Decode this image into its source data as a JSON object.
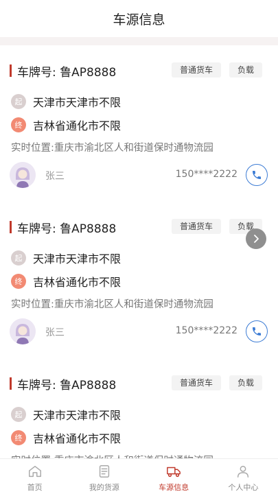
{
  "header": {
    "title": "车源信息"
  },
  "cards": [
    {
      "plate": "车牌号: 鲁AP8888",
      "tags": [
        "普通货车",
        "负载"
      ],
      "start_badge": "起",
      "start": "天津市天津市不限",
      "end_badge": "终",
      "end": "吉林省通化市不限",
      "location": "实时位置:重庆市渝北区人和街道保时通物流园",
      "name": "张三",
      "phone": "150****2222"
    },
    {
      "plate": "车牌号: 鲁AP8888",
      "tags": [
        "普通货车",
        "负载"
      ],
      "start_badge": "起",
      "start": "天津市天津市不限",
      "end_badge": "终",
      "end": "吉林省通化市不限",
      "location": "实时位置:重庆市渝北区人和街道保时通物流园",
      "name": "张三",
      "phone": "150****2222"
    },
    {
      "plate": "车牌号: 鲁AP8888",
      "tags": [
        "普通货车",
        "负载"
      ],
      "start_badge": "起",
      "start": "天津市天津市不限",
      "end_badge": "终",
      "end": "吉林省通化市不限",
      "location": "实时位置:重庆市渝北区人和街道保时通物流园",
      "name": "",
      "phone": ""
    }
  ],
  "tabbar": {
    "items": [
      {
        "label": "首页",
        "icon": "home-icon"
      },
      {
        "label": "我的货源",
        "icon": "cargo-icon"
      },
      {
        "label": "车源信息",
        "icon": "truck-icon"
      },
      {
        "label": "个人中心",
        "icon": "user-icon"
      }
    ],
    "active_index": 2,
    "active_color": "#c0392b"
  },
  "colors": {
    "accent": "#c0392b",
    "end_dot": "#f28a73",
    "start_dot": "#d9cfcf",
    "phone_ring": "#3b7bd4"
  }
}
